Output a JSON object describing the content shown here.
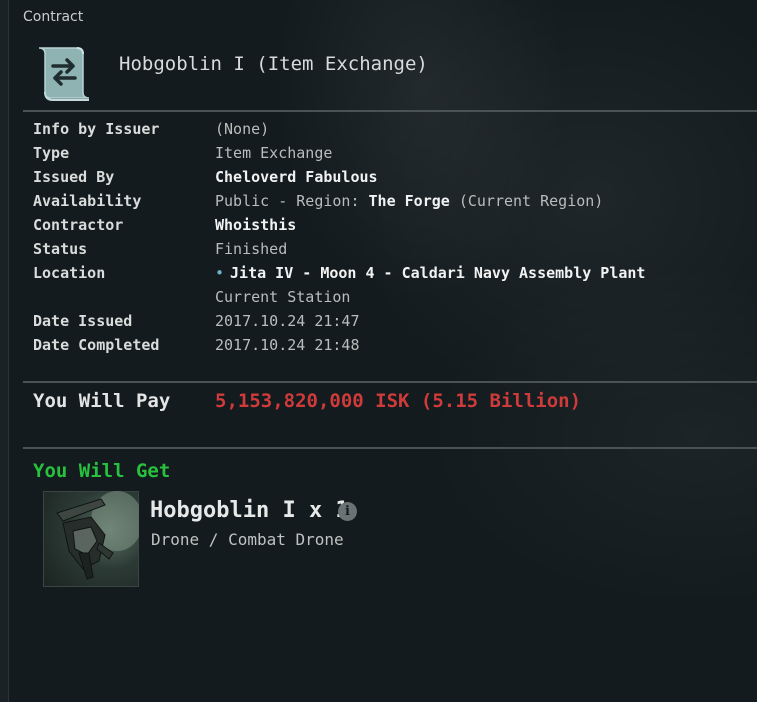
{
  "window": {
    "title": "Contract"
  },
  "contract": {
    "name": "Hobgoblin I (Item Exchange)",
    "icon": "contract-scroll-icon"
  },
  "details": [
    {
      "label": "Info by Issuer",
      "value": "(None)"
    },
    {
      "label": "Type",
      "value": "Item Exchange"
    },
    {
      "label": "Issued By",
      "value": "Cheloverd Fabulous"
    },
    {
      "label": "Availability",
      "value_prefix": "Public - Region: ",
      "value_bold": "The Forge",
      "value_suffix": " (Current Region)"
    },
    {
      "label": "Contractor",
      "value": "Whoisthis"
    },
    {
      "label": "Status",
      "value": "Finished"
    },
    {
      "label": "Location",
      "value": "Jita IV - Moon 4 - Caldari Navy Assembly Plant",
      "value_line2": "Current Station"
    },
    {
      "label": "Date Issued",
      "value": "2017.10.24 21:47"
    },
    {
      "label": "Date Completed",
      "value": "2017.10.24 21:48"
    }
  ],
  "pay": {
    "label": "You Will Pay",
    "value": "5,153,820,000 ISK (5.15 Billion)"
  },
  "get": {
    "label": "You Will Get",
    "item_title": "Hobgoblin I x 1",
    "item_sub": "Drone / Combat Drone",
    "info_icon": "info-icon"
  },
  "colors": {
    "background": "#131b1e",
    "pay_red": "#cf3a3a",
    "get_green": "#27c13d",
    "location_bullet": "#6fb1c9"
  }
}
